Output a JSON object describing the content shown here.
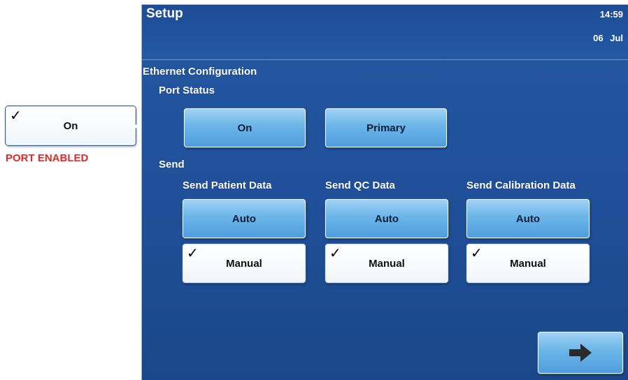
{
  "header": {
    "title": "Setup",
    "time": "14:59",
    "date": "06 Jul"
  },
  "section_title": "Ethernet Configuration",
  "port_status": {
    "label": "Port Status",
    "on_button": "On",
    "primary_button": "Primary"
  },
  "send": {
    "label": "Send",
    "columns": [
      {
        "heading": "Send Patient Data",
        "auto_label": "Auto",
        "manual_label": "Manual",
        "manual_checked": true
      },
      {
        "heading": "Send QC Data",
        "auto_label": "Auto",
        "manual_label": "Manual",
        "manual_checked": true
      },
      {
        "heading": "Send Calibration Data",
        "auto_label": "Auto",
        "manual_label": "Manual",
        "manual_checked": true
      }
    ]
  },
  "annotation": {
    "button_label": "On",
    "checked": true,
    "caption": "PORT ENABLED",
    "caption_color": "#e02a2a"
  },
  "icons": {
    "check": "checkmark-icon",
    "next": "right-arrow-icon"
  },
  "colors": {
    "screen_bg": "#2458a2",
    "button_blue": "#6bb5e8",
    "button_white": "#ffffff",
    "annotation_red": "#e02a2a"
  }
}
